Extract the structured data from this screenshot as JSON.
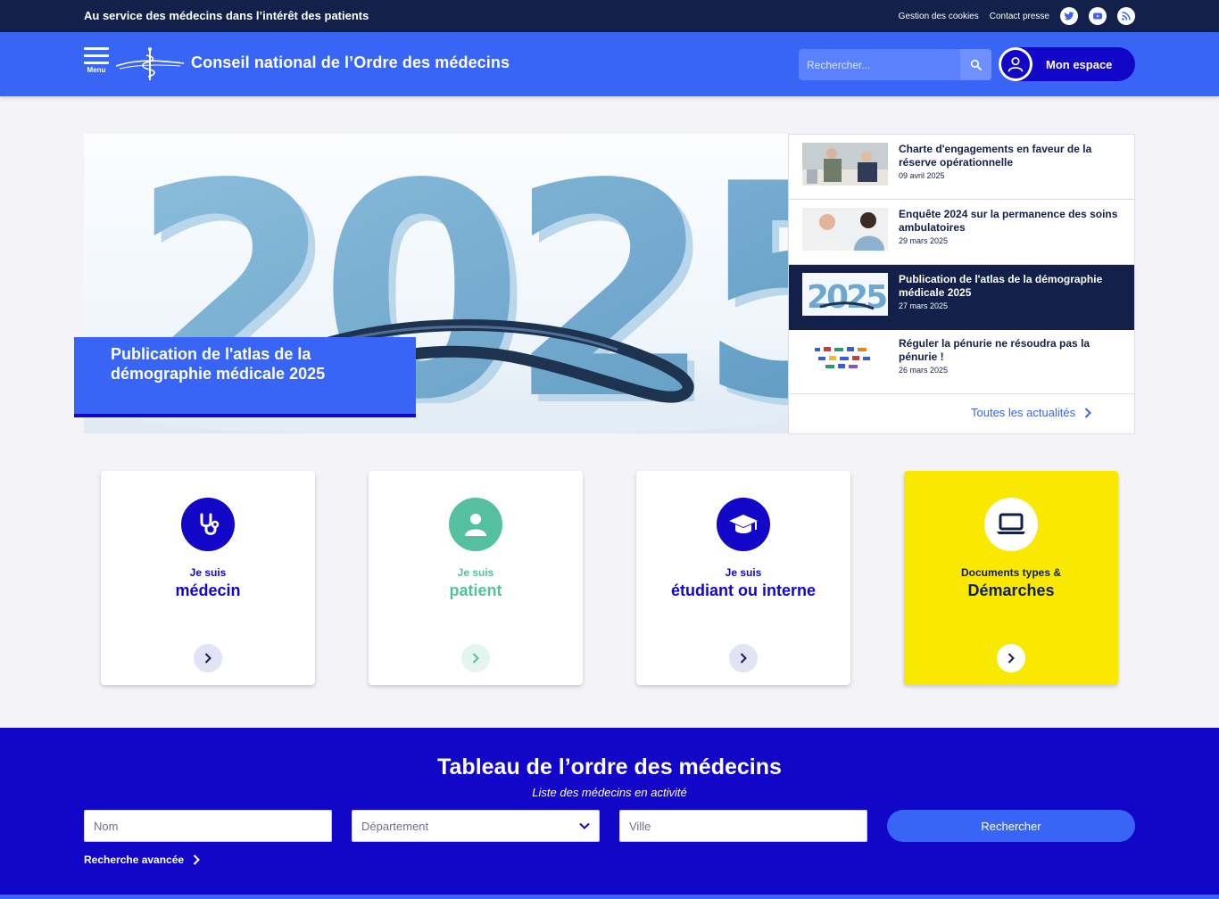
{
  "topbar": {
    "tagline": "Au service des médecins dans l’intérêt des patients",
    "links": [
      "Gestion des cookies",
      "Contact presse"
    ],
    "social_icons": [
      "twitter-icon",
      "youtube-icon",
      "rss-icon"
    ]
  },
  "header": {
    "menu_label": "Menu",
    "site_title": "Conseil national de l’Ordre des médecins",
    "search_placeholder": "Rechercher...",
    "account_label": "Mon espace"
  },
  "hero": {
    "caption": "Publication de l'atlas de la démographie médicale 2025",
    "image_year": "2025"
  },
  "news": {
    "items": [
      {
        "title": "Charte d'engagements en faveur de la réserve opérationnelle",
        "date": "09 avril 2025",
        "active": false
      },
      {
        "title": "Enquête 2024 sur la permanence des soins ambulatoires",
        "date": "29 mars 2025",
        "active": false
      },
      {
        "title": "Publication de l'atlas de la démographie médicale 2025",
        "date": "27 mars 2025",
        "active": true
      },
      {
        "title": "Réguler la pénurie ne résoudra pas la pénurie !",
        "date": "26 mars 2025",
        "active": false
      }
    ],
    "all_label": "Toutes les actualités"
  },
  "cards": [
    {
      "small": "Je suis",
      "big": "médecin",
      "icon": "stethoscope-icon",
      "color": "#1206c8"
    },
    {
      "small": "Je suis",
      "big": "patient",
      "icon": "user-icon",
      "color": "#55c0a0"
    },
    {
      "small": "Je suis",
      "big": "étudiant ou interne",
      "icon": "graduation-cap-icon",
      "color": "#1206c8"
    },
    {
      "small": "Documents types &",
      "big": "Démarches",
      "icon": "laptop-icon",
      "color": "#12204a"
    }
  ],
  "tableau": {
    "title": "Tableau de l’ordre des médecins",
    "subtitle": "Liste des médecins en activité",
    "nom_placeholder": "Nom",
    "departement_placeholder": "Département",
    "ville_placeholder": "Ville",
    "search_label": "Rechercher",
    "advanced_label": "Recherche avancée"
  },
  "colors": {
    "navy": "#12204a",
    "brand_blue": "#3865f5",
    "deep_blue": "#1206c8",
    "teal": "#55c0a0",
    "yellow": "#f9e900"
  }
}
